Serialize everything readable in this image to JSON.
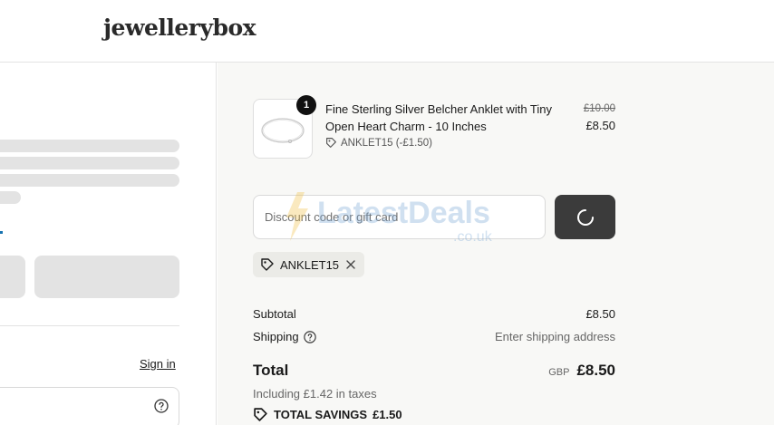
{
  "brand": {
    "logo_text": "jewellerybox"
  },
  "contact": {
    "sign_in_label": "Sign in"
  },
  "order": {
    "item": {
      "name": "Fine Sterling Silver Belcher Anklet with Tiny Open Heart Charm - 10 Inches",
      "quantity": "1",
      "discount_code": "ANKLET15 (-£1.50)",
      "original_price": "£10.00",
      "price": "£8.50",
      "thumbnail_icon": "anklet-image"
    },
    "discount": {
      "placeholder": "Discount code or gift card",
      "apply_state": "loading",
      "applied_code": "ANKLET15"
    },
    "summary": {
      "subtotal_label": "Subtotal",
      "subtotal_value": "£8.50",
      "shipping_label": "Shipping",
      "shipping_value": "Enter shipping address",
      "total_label": "Total",
      "currency": "GBP",
      "total_value": "£8.50",
      "taxes_note": "Including £1.42 in taxes",
      "savings_label": "TOTAL SAVINGS",
      "savings_value": "£1.50"
    }
  },
  "watermark": {
    "text_main": "LatestDeals",
    "text_sub": ".co.uk"
  },
  "colors": {
    "accent": "#1773b0",
    "button_dark": "#3b3b3b",
    "panel_bg": "#f8f8f6",
    "skeleton": "#e3e3e3"
  }
}
